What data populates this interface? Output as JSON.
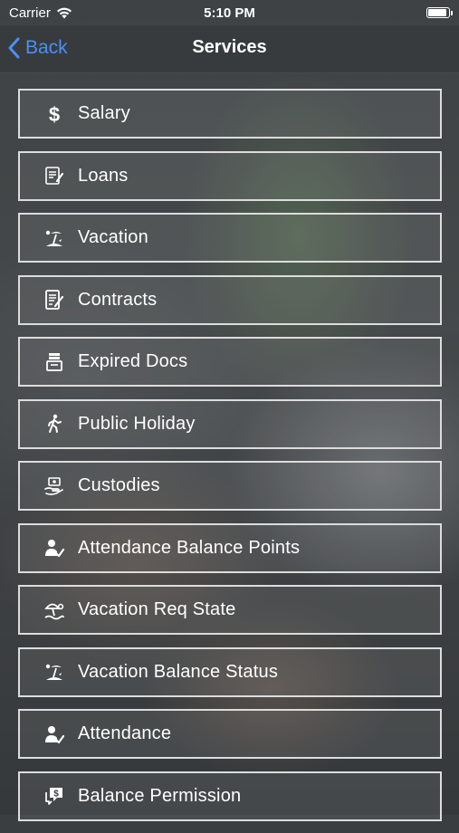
{
  "status_bar": {
    "carrier": "Carrier",
    "time": "5:10 PM",
    "battery_level": 0.85
  },
  "nav": {
    "back_label": "Back",
    "title": "Services"
  },
  "services": [
    {
      "label": "Salary",
      "icon": "dollar-icon"
    },
    {
      "label": "Loans",
      "icon": "loan-document-icon"
    },
    {
      "label": "Vacation",
      "icon": "beach-icon"
    },
    {
      "label": "Contracts",
      "icon": "contract-icon"
    },
    {
      "label": "Expired Docs",
      "icon": "document-stack-icon"
    },
    {
      "label": "Public Holiday",
      "icon": "walking-person-icon"
    },
    {
      "label": "Custodies",
      "icon": "handover-icon"
    },
    {
      "label": "Attendance Balance Points",
      "icon": "user-check-icon"
    },
    {
      "label": "Vacation Req State",
      "icon": "beach-umbrella-icon"
    },
    {
      "label": "Vacation Balance Status",
      "icon": "beach-icon"
    },
    {
      "label": "Attendance",
      "icon": "user-check-icon"
    },
    {
      "label": "Balance Permission",
      "icon": "money-chat-icon"
    }
  ],
  "colors": {
    "accent": "#4a8ff7",
    "border": "#dcdcdc",
    "text": "#ffffff"
  }
}
